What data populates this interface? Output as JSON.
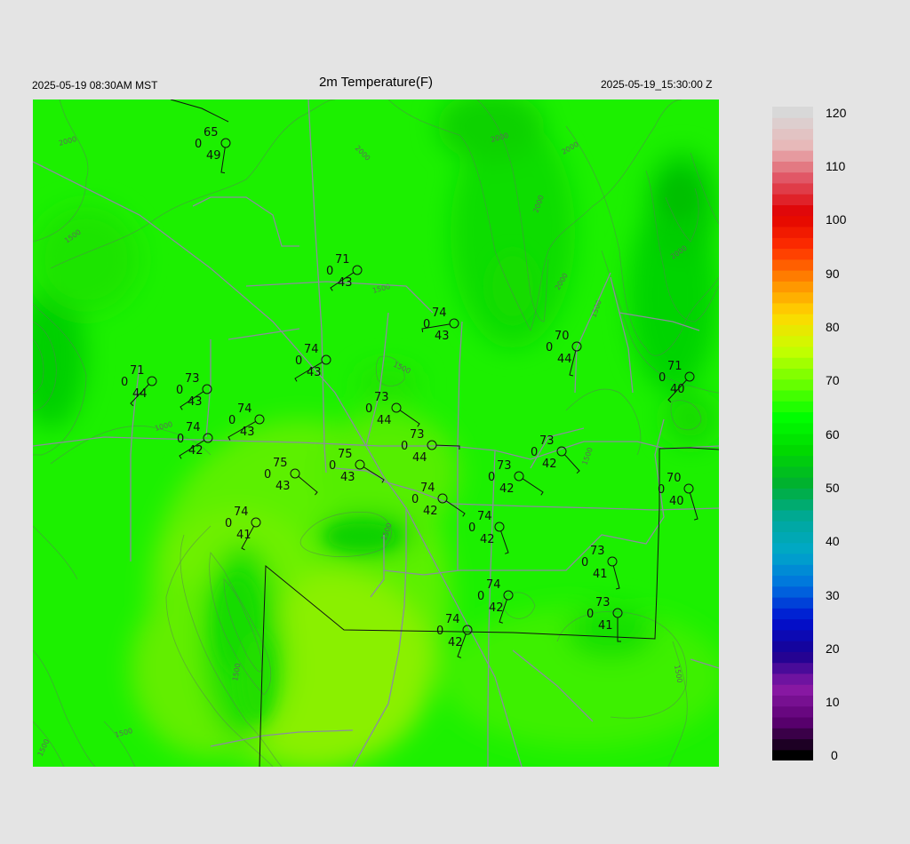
{
  "header": {
    "left_time": "2025-05-19 08:30AM MST",
    "title": "2m Temperature(F)",
    "right_time": "2025-05-19_15:30:00 Z"
  },
  "map": {
    "field": "2m Temperature(F)",
    "contour_labels": [
      "2000",
      "2000",
      "2000",
      "2000",
      "2000",
      "2000",
      "2000",
      "1500",
      "1500",
      "1500",
      "1500",
      "1500",
      "1500",
      "1500",
      "1500",
      "1000",
      "1500",
      "1500"
    ],
    "stations": [
      {
        "temp": "65",
        "dew": "49",
        "wind": "0"
      },
      {
        "temp": "71",
        "dew": "43",
        "wind": "0"
      },
      {
        "temp": "74",
        "dew": "43",
        "wind": "0"
      },
      {
        "temp": "74",
        "dew": "43",
        "wind": "0"
      },
      {
        "temp": "70",
        "dew": "44",
        "wind": "0"
      },
      {
        "temp": "71",
        "dew": "44",
        "wind": "0"
      },
      {
        "temp": "73",
        "dew": "43",
        "wind": "0"
      },
      {
        "temp": "71",
        "dew": "40",
        "wind": "0"
      },
      {
        "temp": "73",
        "dew": "44",
        "wind": "0"
      },
      {
        "temp": "74",
        "dew": "43",
        "wind": "0"
      },
      {
        "temp": "74",
        "dew": "42",
        "wind": "0"
      },
      {
        "temp": "73",
        "dew": "44",
        "wind": "0"
      },
      {
        "temp": "73",
        "dew": "42",
        "wind": "0"
      },
      {
        "temp": "75",
        "dew": "43",
        "wind": "0"
      },
      {
        "temp": "75",
        "dew": "43",
        "wind": "0"
      },
      {
        "temp": "73",
        "dew": "42",
        "wind": "0"
      },
      {
        "temp": "70",
        "dew": "40",
        "wind": "0"
      },
      {
        "temp": "74",
        "dew": "42",
        "wind": "0"
      },
      {
        "temp": "74",
        "dew": "41",
        "wind": "0"
      },
      {
        "temp": "74",
        "dew": "42",
        "wind": "0"
      },
      {
        "temp": "73",
        "dew": "41",
        "wind": "0"
      },
      {
        "temp": "74",
        "dew": "42",
        "wind": "0"
      },
      {
        "temp": "73",
        "dew": "41",
        "wind": "0"
      },
      {
        "temp": "74",
        "dew": "42",
        "wind": "0"
      }
    ]
  },
  "colorbar": {
    "labels": [
      "120",
      "110",
      "100",
      "90",
      "80",
      "70",
      "60",
      "50",
      "40",
      "30",
      "20",
      "10",
      "0"
    ],
    "range": [
      0,
      120
    ],
    "stops": [
      "#000000",
      "#5a0070",
      "#8a1aa6",
      "#1a0090",
      "#0010d0",
      "#0070e0",
      "#00a8c8",
      "#00a89a",
      "#00b030",
      "#00d800",
      "#00ff00",
      "#6aff00",
      "#c8ff00",
      "#ffd800",
      "#ff8c00",
      "#ff3000",
      "#e00000",
      "#e05060",
      "#e8b8b8",
      "#d8d8d8"
    ]
  }
}
